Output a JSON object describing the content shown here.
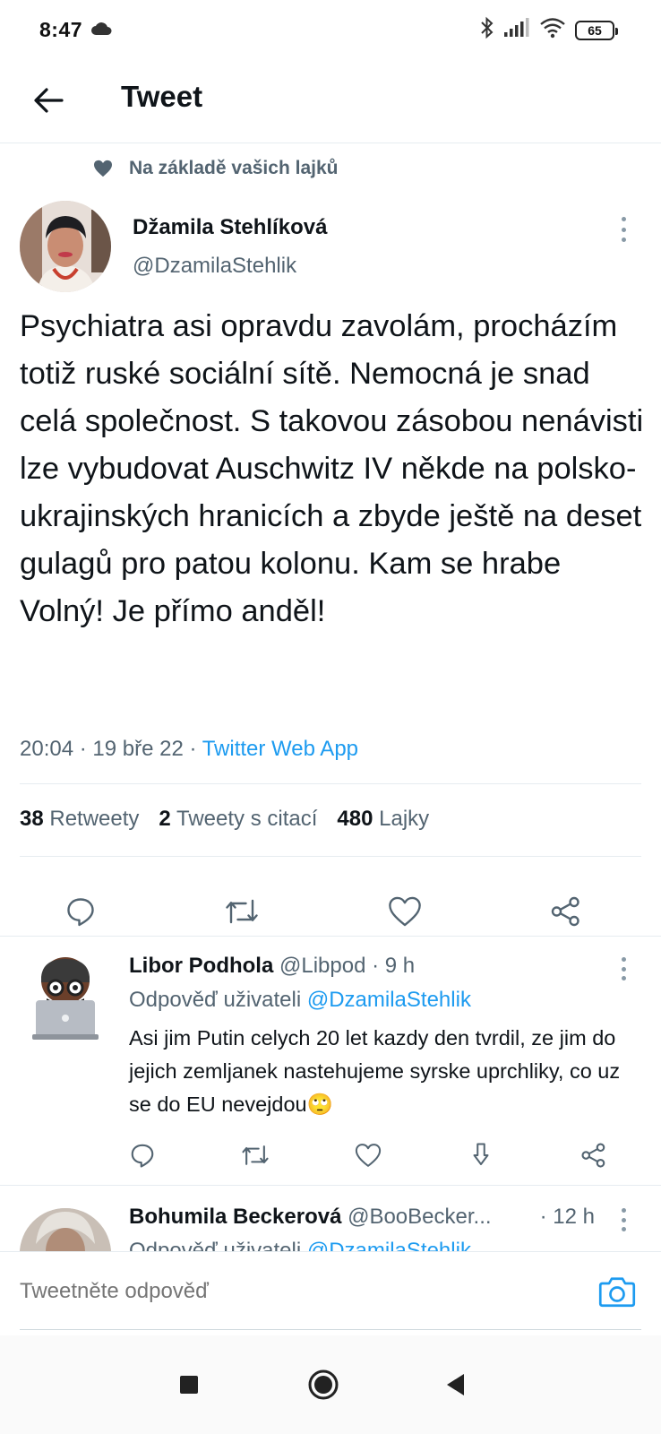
{
  "status_bar": {
    "time": "8:47",
    "battery": "65"
  },
  "header": {
    "title": "Tweet"
  },
  "context": {
    "text": "Na základě vašich lajků"
  },
  "tweet": {
    "author_name": "Džamila Stehlíková",
    "author_handle": "@DzamilaStehlik",
    "text": "Psychiatra asi opravdu zavolám, procházím totiž ruské sociální sítě. Nemocná je snad celá společnost. S takovou zásobou nenávisti lze vybudovat Auschwitz IV někde na polsko-ukrajinských hranicích a zbyde ještě na deset gulagů pro patou kolonu. Kam se hrabe Volný! Je přímo anděl!",
    "timestamp": "20:04 · 19 bře 22 · ",
    "source": "Twitter Web App",
    "stats": {
      "retweets_count": "38",
      "retweets_label": "Retweety",
      "quotes_count": "2",
      "quotes_label": "Tweety s citací",
      "likes_count": "480",
      "likes_label": "Lajky"
    }
  },
  "reply": {
    "name": "Libor Podhola",
    "handle_time": " @Libpod · 9 h",
    "replying_prefix": "Odpověď uživateli ",
    "replying_handle": "@DzamilaStehlik",
    "text": "Asi jim Putin celych 20 let kazdy den tvrdil, ze jim do jejich zemljanek nastehujeme syrske uprchliky, co uz se do EU nevejdou🙄"
  },
  "reply2": {
    "name": "Bohumila Beckerová",
    "handle": " @BooBecker...",
    "time": "· 12 h",
    "replying_prefix": "Odpověď uživateli ",
    "replying_handle": "@DzamilaStehlik"
  },
  "compose": {
    "placeholder": "Tweetněte odpověď"
  },
  "colors": {
    "accent": "#1d9bf0",
    "text_primary": "#0f1419",
    "text_secondary": "#536471",
    "divider": "#e6ecf0"
  }
}
